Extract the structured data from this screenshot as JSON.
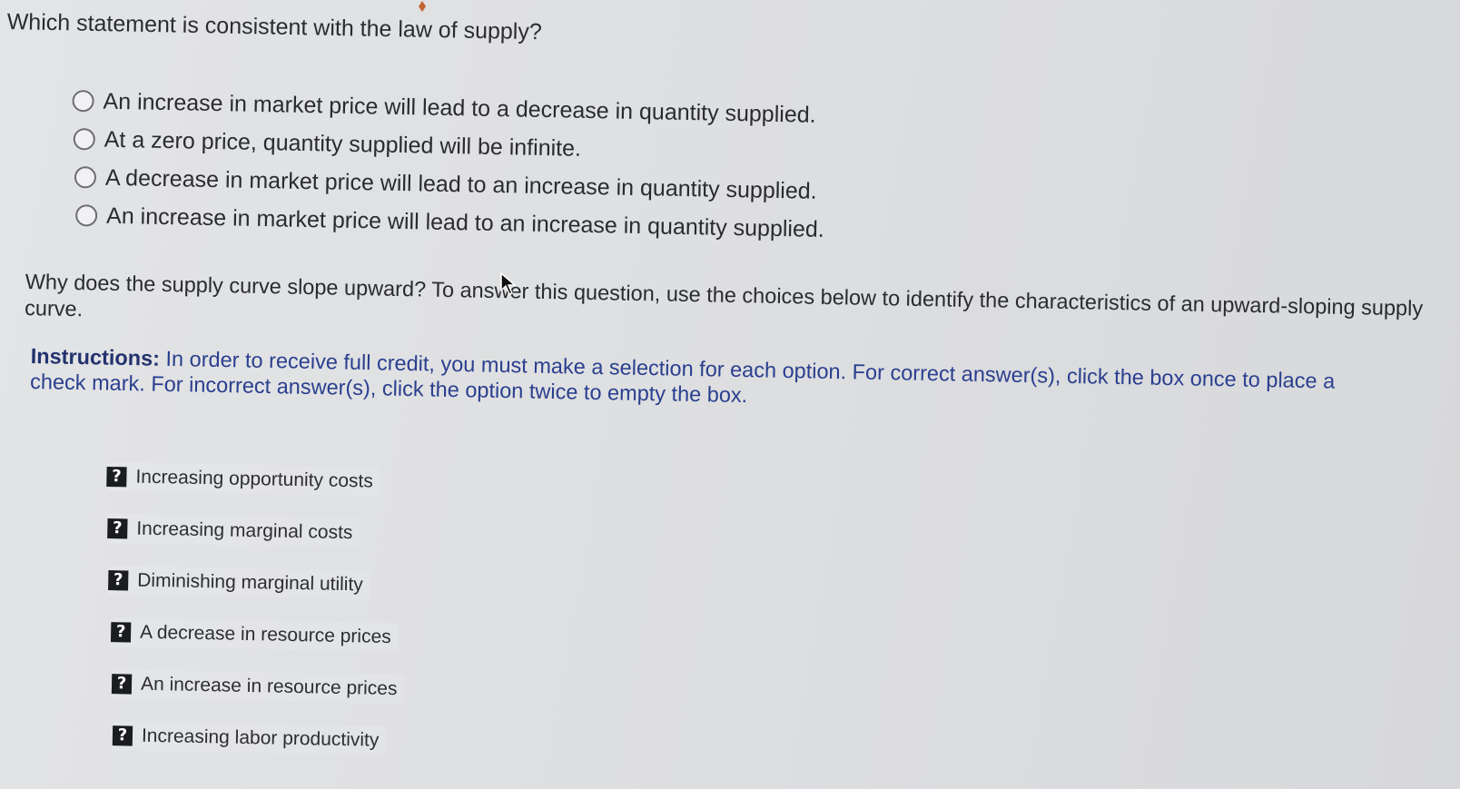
{
  "question1": {
    "title": "Which statement is consistent with the law of supply?",
    "options": [
      {
        "label": "An increase in market price will lead to a decrease in quantity supplied."
      },
      {
        "label": "At a zero price, quantity supplied will be infinite."
      },
      {
        "label": "A decrease in market price will lead to an increase in quantity supplied."
      },
      {
        "label": "An increase in market price will lead to an increase in quantity supplied."
      }
    ]
  },
  "question2": {
    "prompt": "Why does the supply curve slope upward? To answer this question, use the choices below to identify the characteristics of an upward-sloping supply curve.",
    "instructions_label": "Instructions:",
    "instructions_text": " In order to receive full credit, you must make a selection for each option. For correct answer(s), click the box once to place a check mark. For incorrect answer(s), click the option twice to empty the box.",
    "choice_marker": "?",
    "choices": [
      {
        "label": "Increasing opportunity costs"
      },
      {
        "label": "Increasing marginal costs"
      },
      {
        "label": "Diminishing marginal utility"
      },
      {
        "label": "A decrease in resource prices"
      },
      {
        "label": "An increase in resource prices"
      },
      {
        "label": "Increasing labor productivity"
      }
    ]
  },
  "icons": {
    "radio": "radio-unselected-icon",
    "choice_box": "question-mark-box-icon",
    "cursor": "mouse-pointer-icon"
  },
  "colors": {
    "background": "#dedfe1",
    "text": "#2a2b2f",
    "instructions": "#2a3f8e",
    "question_box": "#1b1c1f"
  }
}
